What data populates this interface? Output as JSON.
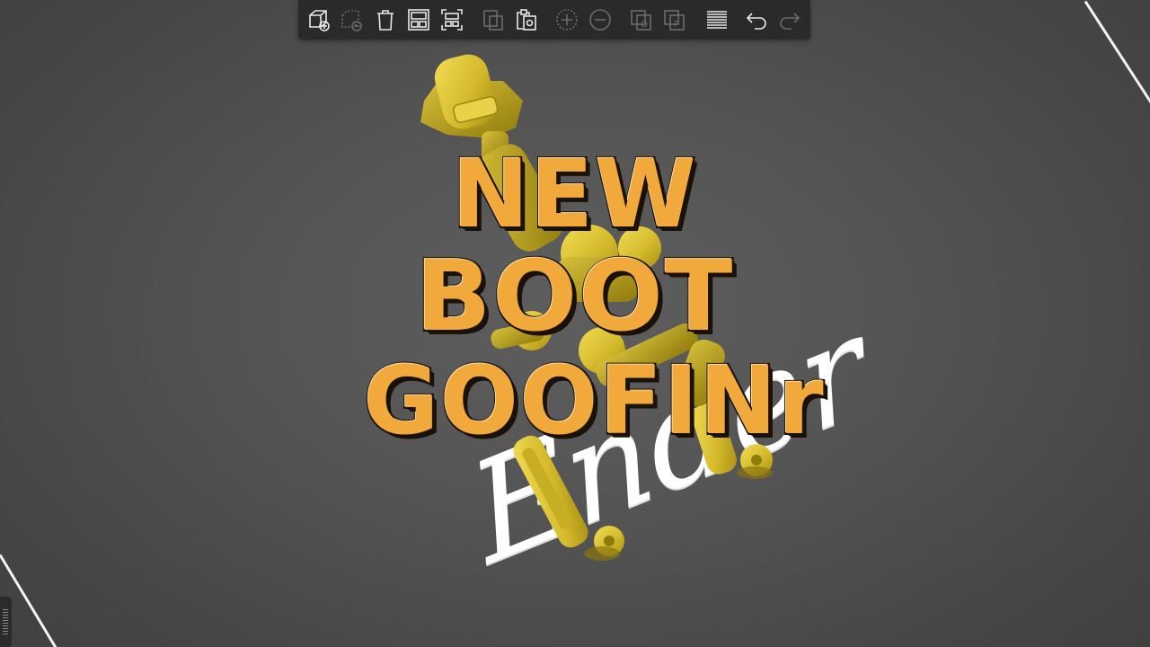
{
  "viewport": {
    "background_color": "#555555",
    "bed_line_color": "#f2f2f2"
  },
  "toolbar": {
    "background_color": "#2a2a2a",
    "buttons": [
      {
        "icon": "add-object-icon",
        "state": "enabled"
      },
      {
        "icon": "delete-object-icon",
        "state": "disabled"
      },
      {
        "icon": "delete-all-icon",
        "state": "enabled"
      },
      {
        "icon": "arrange-icon",
        "state": "enabled"
      },
      {
        "icon": "arrange-selection-icon",
        "state": "enabled"
      },
      {
        "icon": "copy-icon",
        "state": "disabled"
      },
      {
        "icon": "paste-icon",
        "state": "enabled"
      },
      {
        "icon": "add-instance-icon",
        "state": "disabled"
      },
      {
        "icon": "remove-instance-icon",
        "state": "disabled"
      },
      {
        "icon": "split-to-objects-icon",
        "state": "disabled"
      },
      {
        "icon": "split-to-parts-icon",
        "state": "disabled"
      },
      {
        "icon": "layers-editing-icon",
        "state": "enabled"
      },
      {
        "icon": "undo-icon",
        "state": "enabled"
      },
      {
        "icon": "redo-icon",
        "state": "disabled"
      }
    ],
    "split_objects_glyph": "O",
    "split_parts_glyph": "P"
  },
  "model": {
    "color": "#d9c13a"
  },
  "bed_text": {
    "word": "Ender"
  },
  "title": {
    "line1": "NEW",
    "line2": "BOOT",
    "line3": "GOOFINr",
    "fill_color": "#f0a93a",
    "outline_color": "#1a1208"
  }
}
